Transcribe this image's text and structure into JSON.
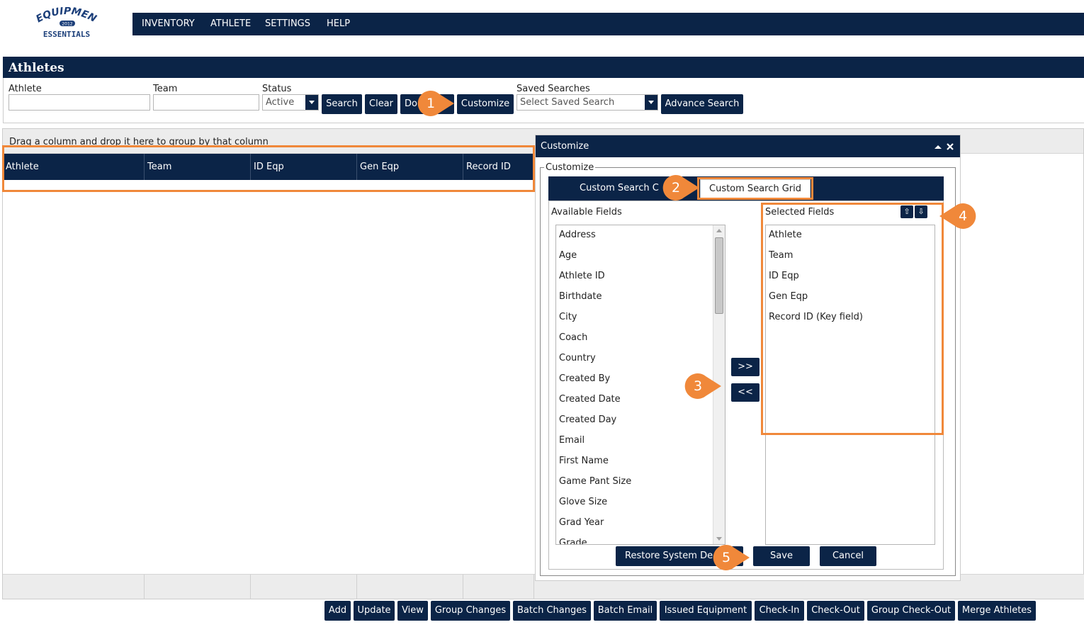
{
  "logo": {
    "line1": "EQUIPMENT",
    "badge": "2012",
    "line2": "ESSENTIALS"
  },
  "nav": {
    "items": [
      "INVENTORY",
      "ATHLETE",
      "SETTINGS",
      "HELP"
    ]
  },
  "page": {
    "title": "Athletes"
  },
  "search": {
    "athlete_label": "Athlete",
    "athlete_value": "",
    "team_label": "Team",
    "team_value": "",
    "status_label": "Status",
    "status_value": "Active",
    "search_button": "Search",
    "clear_button": "Clear",
    "do_button": "Do",
    "customize_button": "Customize",
    "saved_label": "Saved Searches",
    "saved_value": "Select Saved Search",
    "advance_button": "Advance Search"
  },
  "grid": {
    "group_hint": "Drag a column and drop it here to group by that column",
    "columns": [
      "Athlete",
      "Team",
      "ID Eqp",
      "Gen Eqp",
      "Record ID"
    ]
  },
  "bottom_buttons": [
    "Add",
    "Update",
    "View",
    "Group Changes",
    "Batch Changes",
    "Batch Email",
    "Issued Equipment",
    "Check-In",
    "Check-Out",
    "Group Check-Out",
    "Merge Athletes"
  ],
  "dialog": {
    "title": "Customize",
    "legend": "Customize",
    "tab_left": "Custom Search C",
    "tab_right": "Custom Search Grid",
    "available_label": "Available Fields",
    "selected_label": "Selected Fields",
    "available_fields": [
      "Address",
      "Age",
      "Athlete ID",
      "Birthdate",
      "City",
      "Coach",
      "Country",
      "Created By",
      "Created Date",
      "Created Day",
      "Email",
      "First Name",
      "Game Pant Size",
      "Glove Size",
      "Grad Year",
      "Grade"
    ],
    "selected_fields": [
      "Athlete",
      "Team",
      "ID Eqp",
      "Gen Eqp",
      "Record ID (Key field)"
    ],
    "add_button": ">>",
    "remove_button": "<<",
    "up_button": "⇧",
    "down_button": "⇩",
    "restore_button": "Restore System De",
    "save_button": "Save",
    "cancel_button": "Cancel"
  },
  "callouts": [
    "1",
    "2",
    "3",
    "4",
    "5"
  ],
  "colors": {
    "navy": "#0b2447",
    "orange": "#f0883a"
  }
}
